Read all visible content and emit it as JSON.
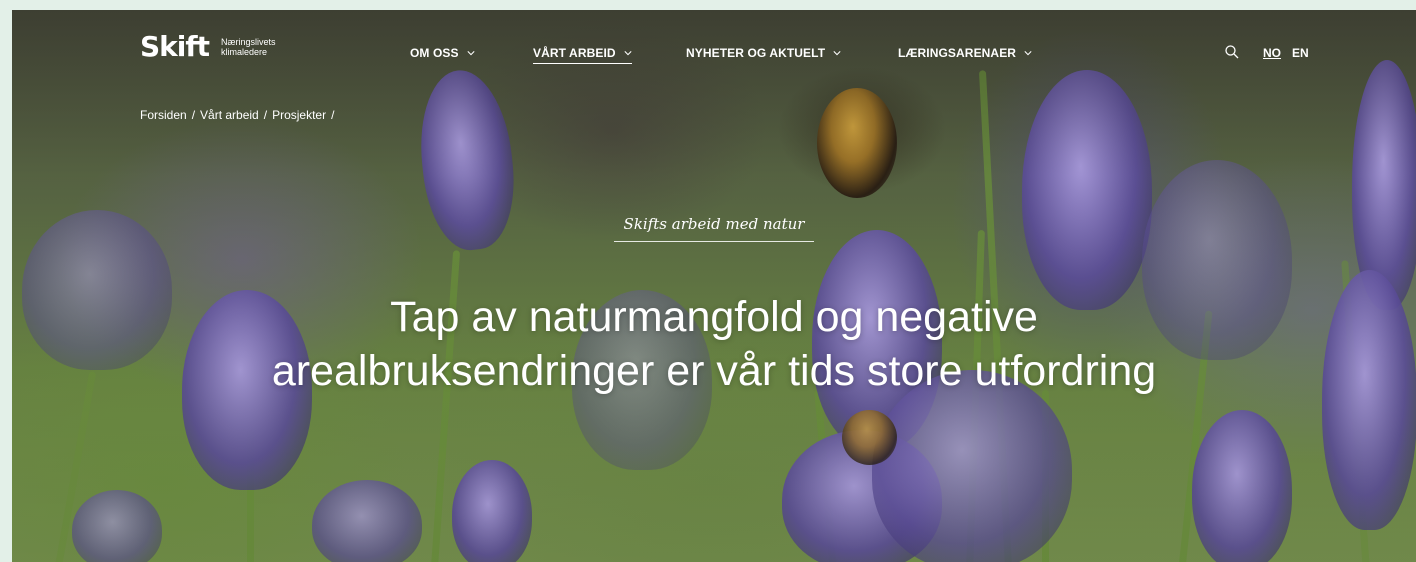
{
  "logo": {
    "wordmark": "Skift",
    "tagline_line1": "Næringslivets",
    "tagline_line2": "klimaledere"
  },
  "nav": {
    "items": [
      {
        "label": "OM OSS",
        "icon": "chevron-down-icon"
      },
      {
        "label": "VÅRT ARBEID",
        "icon": "chevron-down-icon",
        "active": true
      },
      {
        "label": "NYHETER OG AKTUELT",
        "icon": "chevron-down-icon"
      },
      {
        "label": "LÆRINGSARENAER",
        "icon": "chevron-down-icon"
      }
    ],
    "search_icon": "search-icon",
    "languages": [
      {
        "label": "NO",
        "active": true
      },
      {
        "label": "EN"
      }
    ]
  },
  "breadcrumb": {
    "items": [
      "Forsiden",
      "Vårt arbeid",
      "Prosjekter"
    ],
    "separator": "/"
  },
  "hero": {
    "kicker": "Skifts arbeid med natur",
    "headline_line1": "Tap av naturmangfold og negative",
    "headline_line2": "arealbruksendringer er vår tids store utfordring",
    "background_description_colors": {
      "lavender": "#8a78c8",
      "grass": "#6d8a45"
    }
  },
  "colors": {
    "page_bg": "#e3f0e8",
    "text": "#ffffff"
  }
}
